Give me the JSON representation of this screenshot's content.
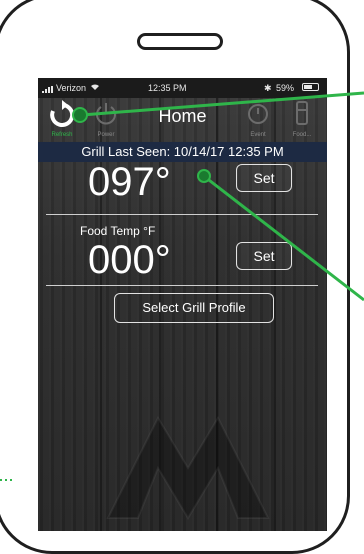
{
  "status_bar": {
    "carrier": "Verizon",
    "time": "12:35 PM",
    "battery": "59%",
    "battery_level": 0.59
  },
  "nav": {
    "title": "Home",
    "refresh_label": "Refresh",
    "power_label": "Power",
    "timer_label": "Event",
    "probe_label": "Food..."
  },
  "last_seen": "Grill Last Seen: 10/14/17 12:35 PM",
  "grill": {
    "temp": "097°",
    "set_label": "Set"
  },
  "food": {
    "label": "Food Temp °F",
    "temp": "000°",
    "set_label": "Set"
  },
  "profile_button": "Select Grill Profile",
  "colors": {
    "accent_line": "#2fb54a",
    "banner": "#1d2a43"
  }
}
